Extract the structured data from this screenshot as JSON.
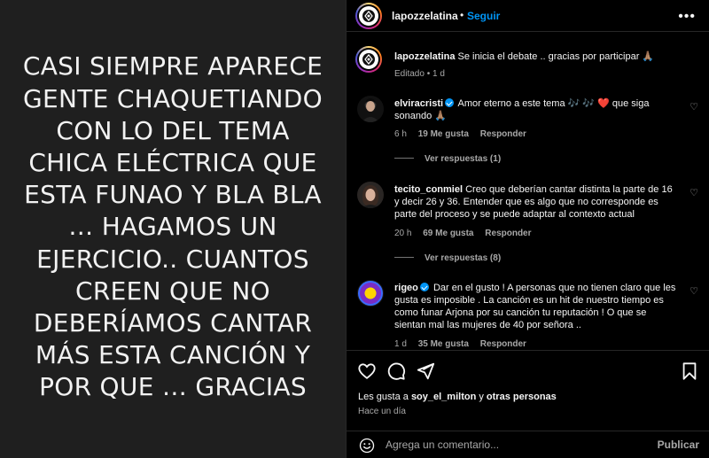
{
  "post_image": {
    "text": "CASI SIEMPRE APARECE GENTE CHAQUETIANDO CON LO DEL TEMA CHICA ELÉCTRICA QUE ESTA FUNAO Y BLA BLA … HAGAMOS UN EJERCICIO.. CUANTOS CREEN QUE NO DEBERÍAMOS CANTAR MÁS ESTA CANCIÓN Y POR QUE … GRACIAS"
  },
  "header": {
    "username": "lapozzelatina",
    "separator": "•",
    "follow_label": "Seguir",
    "more_icon": "more-horizontal-icon"
  },
  "caption": {
    "username": "lapozzelatina",
    "text": "Se inicia el debate .. gracias por participar 🙏🏽",
    "meta_edited": "Editado",
    "meta_sep": "•",
    "meta_time": "1 d"
  },
  "comments": [
    {
      "username": "elviracristi",
      "verified": true,
      "text": "Amor eterno a este tema 🎶 🎶 ❤️  que siga sonando 🙏🏽",
      "time": "6 h",
      "likes": "19 Me gusta",
      "reply_label": "Responder",
      "view_replies": "Ver respuestas (1)"
    },
    {
      "username": "tecito_conmiel",
      "verified": false,
      "text": "Creo que deberían cantar distinta la parte de 16 y decir 26 y 36. Entender que es algo que no corresponde es parte del proceso y se puede adaptar al contexto actual",
      "time": "20 h",
      "likes": "69 Me gusta",
      "reply_label": "Responder",
      "view_replies": "Ver respuestas (8)"
    },
    {
      "username": "rigeo",
      "verified": true,
      "text": "Dar en el gusto ! A personas que no tienen claro que les gusta es imposible . La canción es un hit de nuestro tiempo es como funar Arjona por su canción tu reputación ! O que se sientan mal las mujeres de 40 por señora ..",
      "time": "1 d",
      "likes": "35 Me gusta",
      "reply_label": "Responder"
    }
  ],
  "actions": {
    "likes_prefix": "Les gusta a ",
    "likes_user": "soy_el_milton",
    "likes_suffix": " y ",
    "likes_others": "otras personas",
    "time_ago": "Hace un día"
  },
  "comment_bar": {
    "placeholder": "Agrega un comentario...",
    "publish_label": "Publicar"
  },
  "colors": {
    "accent": "#0095f6",
    "secondary_text": "#a8a8a8",
    "image_bg": "#1f1f1f"
  }
}
